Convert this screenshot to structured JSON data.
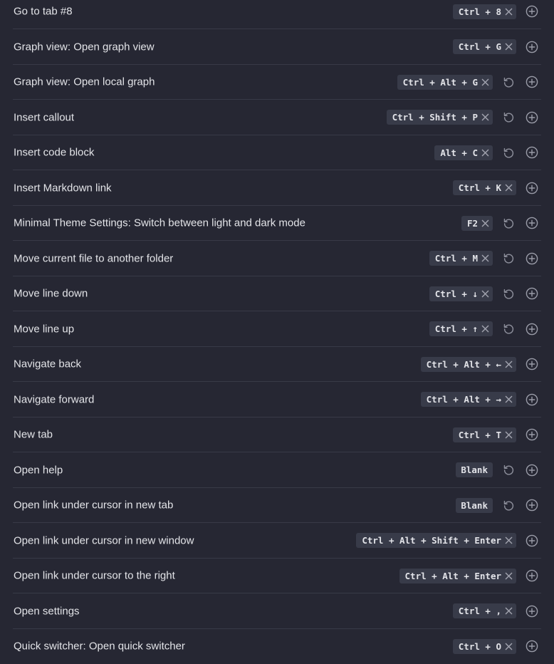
{
  "commands": [
    {
      "label": "Go to tab #8",
      "hotkey": "Ctrl + 8",
      "removable": true,
      "restorable": false
    },
    {
      "label": "Graph view: Open graph view",
      "hotkey": "Ctrl + G",
      "removable": true,
      "restorable": false
    },
    {
      "label": "Graph view: Open local graph",
      "hotkey": "Ctrl + Alt + G",
      "removable": true,
      "restorable": true
    },
    {
      "label": "Insert callout",
      "hotkey": "Ctrl + Shift + P",
      "removable": true,
      "restorable": true
    },
    {
      "label": "Insert code block",
      "hotkey": "Alt + C",
      "removable": true,
      "restorable": true
    },
    {
      "label": "Insert Markdown link",
      "hotkey": "Ctrl + K",
      "removable": true,
      "restorable": false
    },
    {
      "label": "Minimal Theme Settings: Switch between light and dark mode",
      "hotkey": "F2",
      "removable": true,
      "restorable": true
    },
    {
      "label": "Move current file to another folder",
      "hotkey": "Ctrl + M",
      "removable": true,
      "restorable": true
    },
    {
      "label": "Move line down",
      "hotkey": "Ctrl + ↓",
      "removable": true,
      "restorable": true
    },
    {
      "label": "Move line up",
      "hotkey": "Ctrl + ↑",
      "removable": true,
      "restorable": true
    },
    {
      "label": "Navigate back",
      "hotkey": "Ctrl + Alt + ←",
      "removable": true,
      "restorable": false
    },
    {
      "label": "Navigate forward",
      "hotkey": "Ctrl + Alt + →",
      "removable": true,
      "restorable": false
    },
    {
      "label": "New tab",
      "hotkey": "Ctrl + T",
      "removable": true,
      "restorable": false
    },
    {
      "label": "Open help",
      "hotkey": "Blank",
      "removable": false,
      "restorable": true
    },
    {
      "label": "Open link under cursor in new tab",
      "hotkey": "Blank",
      "removable": false,
      "restorable": true
    },
    {
      "label": "Open link under cursor in new window",
      "hotkey": "Ctrl + Alt + Shift + Enter",
      "removable": true,
      "restorable": false
    },
    {
      "label": "Open link under cursor to the right",
      "hotkey": "Ctrl + Alt + Enter",
      "removable": true,
      "restorable": false
    },
    {
      "label": "Open settings",
      "hotkey": "Ctrl + ,",
      "removable": true,
      "restorable": false
    },
    {
      "label": "Quick switcher: Open quick switcher",
      "hotkey": "Ctrl + O",
      "removable": true,
      "restorable": false
    }
  ],
  "icons": {
    "remove": "close-icon",
    "restore": "restore-default-icon",
    "add": "add-hotkey-icon"
  },
  "colors": {
    "background": "#262733",
    "chip": "#383b49",
    "divider": "#383a47",
    "icon": "#9a9ca8"
  }
}
